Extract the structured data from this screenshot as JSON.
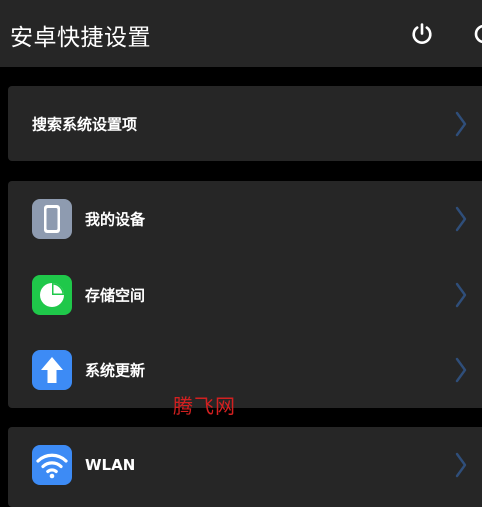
{
  "header": {
    "title": "安卓快捷设置",
    "power_icon": "power-icon",
    "more_icon": "more-icon"
  },
  "search": {
    "label": "搜索系统设置项"
  },
  "group1": {
    "items": [
      {
        "label": "我的设备",
        "icon": "phone-device-icon",
        "color": "#8e9bb0"
      },
      {
        "label": "存储空间",
        "icon": "pie-chart-icon",
        "color": "#1fc84a"
      },
      {
        "label": "系统更新",
        "icon": "arrow-up-icon",
        "color": "#3d8bf5"
      }
    ]
  },
  "group2": {
    "items": [
      {
        "label": "WLAN",
        "icon": "wifi-icon",
        "color": "#3d8bf5"
      }
    ]
  },
  "watermark": "腾飞网",
  "colors": {
    "background": "#000000",
    "card": "#262626",
    "chevron": "#2f4e7a",
    "text": "#ffffff"
  }
}
